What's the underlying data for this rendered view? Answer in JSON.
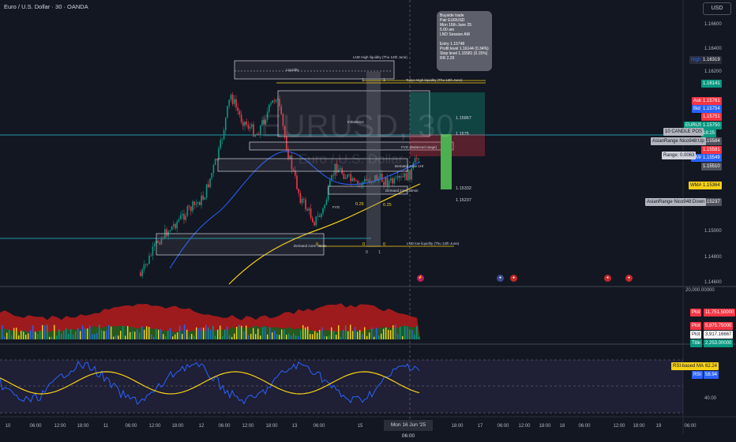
{
  "header": {
    "symbol_title": "Euro / U.S. Dollar · 30 · OANDA",
    "currency": "USD"
  },
  "watermark": {
    "symbol": "EURUSD, 30",
    "name": "Euro / U.S. Dollar"
  },
  "tooltip": {
    "lines": [
      "Buyside trade",
      "Pair EURUSD",
      "Mon 16th June 25",
      "5.00 am",
      "LND Session AM",
      "",
      "Entry 1.15748",
      "Profit level 1.16144 (0.34%)",
      "Stop level 1.15581 (0.15%)",
      "RR 2.29"
    ]
  },
  "price_axis": {
    "ticks": [
      "1.16600",
      "1.16400",
      "1.16200",
      "1.15000",
      "1.14800",
      "1.14600",
      "20,000.00000",
      "40.00"
    ]
  },
  "price_tags": [
    {
      "label": "High",
      "value": "1.16319",
      "color": "#2a2e39",
      "label_color": "#2962ff"
    },
    {
      "label": "",
      "value": "1.16141",
      "color": "#089981"
    },
    {
      "label": "Ask",
      "value": "1.15761",
      "color": "#f23645"
    },
    {
      "label": "Bid",
      "value": "1.15754",
      "color": "#2962ff"
    },
    {
      "label": "",
      "value": "1.15751",
      "color": "#f23645"
    },
    {
      "label": "EURUSD",
      "value": "1.15750",
      "sub": "18:25",
      "color": "#089981"
    },
    {
      "label": "",
      "value": "1.15584",
      "color": "#50535e"
    },
    {
      "label": "",
      "value": "1.15581",
      "color": "#f23645"
    },
    {
      "label": "EMA",
      "value": "1.15549",
      "color": "#2962ff"
    },
    {
      "label": "",
      "value": "1.15510",
      "color": "#50535e"
    },
    {
      "label": "WMA",
      "value": "1.15364",
      "color": "#f7d117",
      "dark": true
    },
    {
      "label": "",
      "value": "1.15237",
      "color": "#50535e"
    }
  ],
  "side_tags": {
    "candle_pos": "10 CANDLE POS",
    "asian_up": "AsianRange Nico948:Up",
    "range": "Range: 0.0063",
    "asian_down": "AsianRange Nico948:Down"
  },
  "indicator_tags": [
    {
      "label": "Plot",
      "value": "11,751.50000",
      "color": "#f23645"
    },
    {
      "label": "Plot",
      "value": "5,875.75000",
      "color": "#f23645"
    },
    {
      "label": "Plot",
      "value": "3,917.16667",
      "color": "#ffffff",
      "dark": true
    },
    {
      "label": "Title",
      "value": "2,253.00000",
      "color": "#089981"
    },
    {
      "label": "RSI-based MA",
      "value": "62.24",
      "color": "#f7d117",
      "dark": true
    },
    {
      "label": "RSI",
      "value": "58.94",
      "color": "#2962ff"
    }
  ],
  "chart_labels": {
    "lnd_high": "LND High liquidity (Thu 12th June)",
    "liquidity": "Liquidity",
    "tokyo_high": "Tokyo High liquidity (Thu 12th June)",
    "imbalance": "Imbalance",
    "fvg_cf": "FVG (Balanced range)",
    "demand_1h": "Demand zone 1Hr",
    "demand_30": "Demand zone 30min",
    "fvg": "FVG",
    "lnd_low": "LND low liquidity (Thu 12th June)",
    "lvl_15867": "1.15867",
    "lvl_1575": "1.1575",
    "lvl_15332": "1.15332",
    "lvl_15237": "1.15237",
    "fib_025a": "0.25",
    "fib_025b": "0.25",
    "fib_1a": "1",
    "fib_1b": "1",
    "fib_0a": "0",
    "fib_0b": "0",
    "fib_0c": "0",
    "fib_1c": "1",
    "fib_0d": "0"
  },
  "time_axis": {
    "labels": [
      "10",
      "06:00",
      "12:00",
      "18:00",
      "11",
      "06:00",
      "12:00",
      "18:00",
      "12",
      "06:00",
      "12:00",
      "18:00",
      "13",
      "06:00",
      "15",
      "18:00",
      "17",
      "06:00",
      "12:00",
      "18:00",
      "18",
      "06:00",
      "12:00",
      "18:00",
      "19",
      "06:00"
    ],
    "selected": "Mon 16 Jun '25  06:00"
  },
  "colors": {
    "bg": "#131722",
    "up": "#089981",
    "down": "#f23645",
    "ema": "#2962ff",
    "wma": "#f7d117",
    "rsi": "#2962ff",
    "rsima": "#f7d117"
  }
}
